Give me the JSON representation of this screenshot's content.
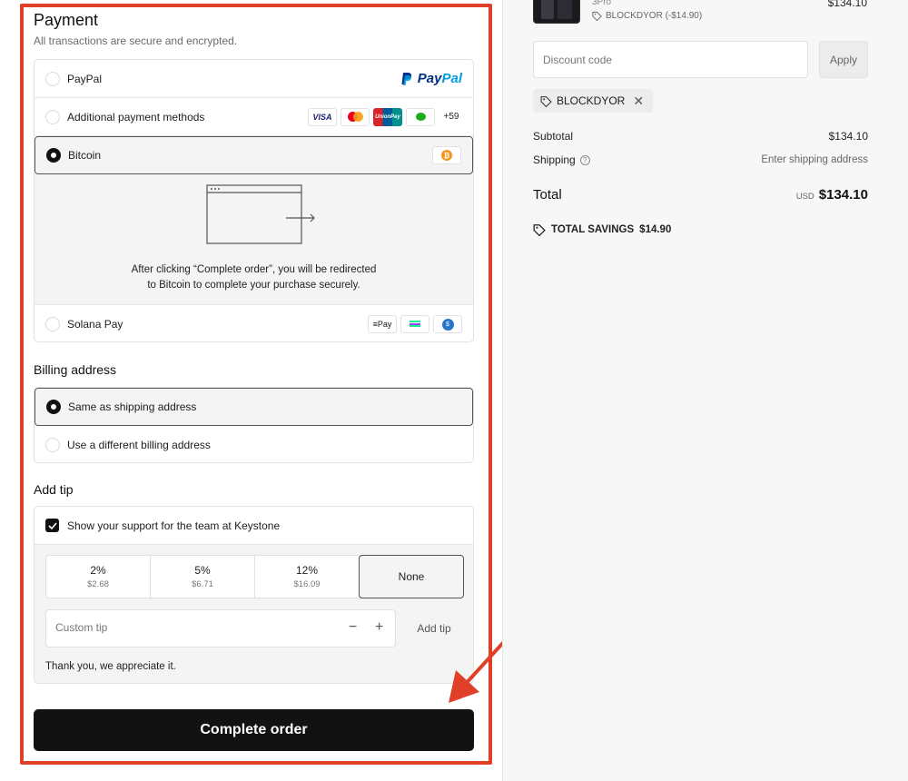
{
  "payment": {
    "title": "Payment",
    "subtitle": "All transactions are secure and encrypted.",
    "methods": {
      "paypal": {
        "label": "PayPal",
        "logo_pay": "Pay",
        "logo_pal": "Pal"
      },
      "additional": {
        "label": "Additional payment methods",
        "visa": "VISA",
        "unionpay": "UnionPay",
        "more_count": "+59"
      },
      "bitcoin": {
        "label": "Bitcoin",
        "icon_glyph": "₿"
      },
      "solana": {
        "label": "Solana Pay",
        "spay": "≡Pay"
      }
    },
    "redirect_text_line1": "After clicking “Complete order”, you will be redirected",
    "redirect_text_line2": "to Bitcoin to complete your purchase securely.",
    "selected_method": "bitcoin"
  },
  "billing": {
    "title": "Billing address",
    "same": "Same as shipping address",
    "different": "Use a different billing address",
    "selected": "same"
  },
  "tip": {
    "title": "Add tip",
    "support_label": "Show your support for the team at Keystone",
    "support_checked": true,
    "options": [
      {
        "pct": "2%",
        "amount": "$2.68"
      },
      {
        "pct": "5%",
        "amount": "$6.71"
      },
      {
        "pct": "12%",
        "amount": "$16.09"
      }
    ],
    "none_label": "None",
    "custom_placeholder": "Custom tip",
    "minus": "−",
    "plus": "+",
    "add_button": "Add tip",
    "thanks": "Thank you, we appreciate it."
  },
  "complete_button": "Complete order",
  "summary": {
    "product_variant": "3Pro",
    "product_discount": "BLOCKDYOR (-$14.90)",
    "product_price": "$134.10",
    "discount_placeholder": "Discount code",
    "apply_label": "Apply",
    "applied_code": "BLOCKDYOR",
    "subtotal_label": "Subtotal",
    "subtotal_value": "$134.10",
    "shipping_label": "Shipping",
    "shipping_value": "Enter shipping address",
    "total_label": "Total",
    "total_currency": "USD",
    "total_value": "$134.10",
    "savings_label": "TOTAL SAVINGS",
    "savings_value": "$14.90"
  },
  "colors": {
    "highlight": "#e0402a",
    "button": "#121212",
    "paypal_dark": "#003087",
    "paypal_light": "#009cde",
    "bitcoin": "#f7931a"
  }
}
